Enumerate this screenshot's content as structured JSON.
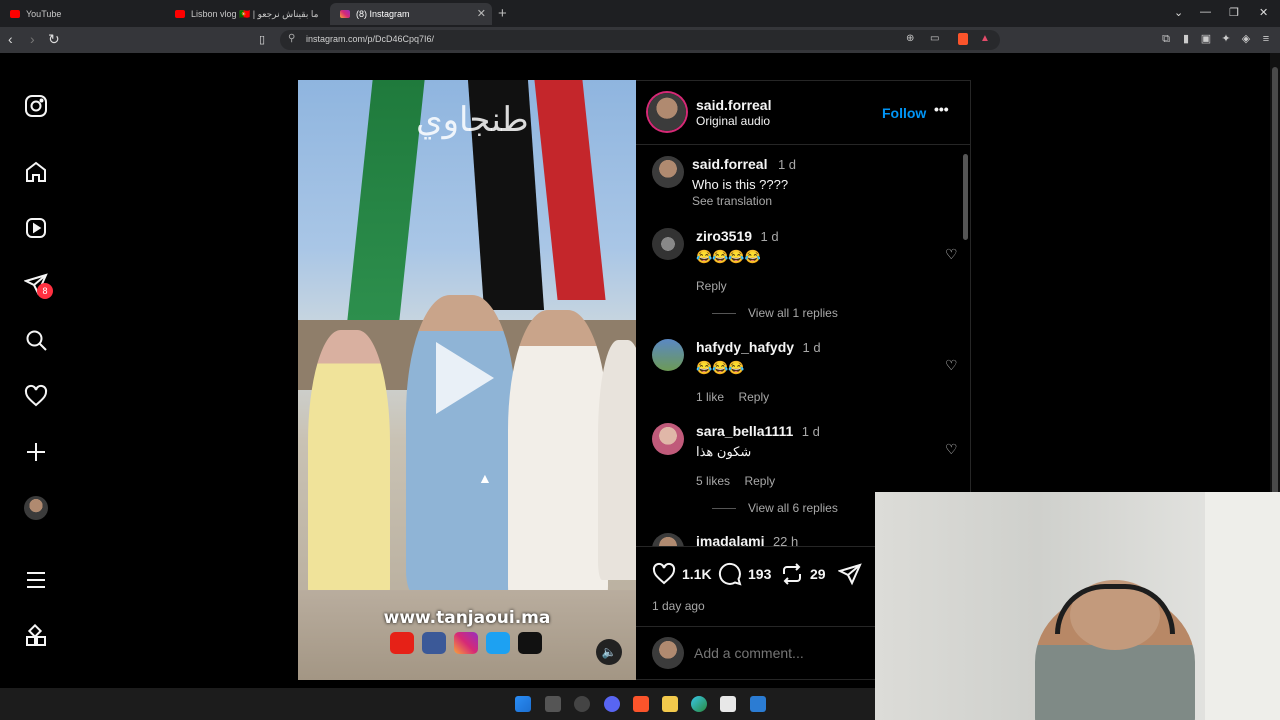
{
  "browser": {
    "tabs": [
      {
        "title": "YouTube",
        "active": false
      },
      {
        "title": "Lisbon vlog 🇵🇹 | ما بقيناش نرجعو",
        "active": false
      },
      {
        "title": "(8) Instagram",
        "active": true
      }
    ],
    "url": "instagram.com/p/DcD46Cpq7I6/"
  },
  "sidebar": {
    "notification_count": "8",
    "items": [
      "instagram-logo",
      "home",
      "reels",
      "messages",
      "search",
      "notifications",
      "create",
      "profile",
      "menu",
      "more"
    ]
  },
  "video": {
    "watermark_text": "طنجاوي",
    "website_text": "www.tanjaoui.ma",
    "social_icons": [
      "youtube",
      "facebook",
      "instagram",
      "twitter",
      "tiktok"
    ]
  },
  "post": {
    "author": "said.forreal",
    "audio": "Original audio",
    "follow_label": "Follow",
    "more_icon": "•••",
    "caption": {
      "user": "said.forreal",
      "time": "1 d",
      "text": "Who is this ????",
      "see_translation": "See translation"
    },
    "comments": [
      {
        "user": "ziro3519",
        "time": "1 d",
        "text": "😂😂😂😂",
        "likes": "",
        "reply": "Reply",
        "view_replies": "View all 1 replies"
      },
      {
        "user": "hafydy_hafydy",
        "time": "1 d",
        "text": "😂😂😂",
        "likes": "1 like",
        "reply": "Reply",
        "view_replies": ""
      },
      {
        "user": "sara_bella1111",
        "time": "1 d",
        "text": "شكون هذا",
        "likes": "5 likes",
        "reply": "Reply",
        "view_replies": "View all 6 replies"
      },
      {
        "user": "imadalami",
        "time": "22 h",
        "text": "",
        "likes": "",
        "reply": "",
        "view_replies": ""
      }
    ],
    "stats": {
      "likes": "1.1K",
      "comments": "193",
      "reposts": "29"
    },
    "posted": "1 day ago",
    "add_comment_placeholder": "Add a comment..."
  },
  "colors": {
    "accent_blue": "#0095f6",
    "badge_red": "#ff3040"
  }
}
